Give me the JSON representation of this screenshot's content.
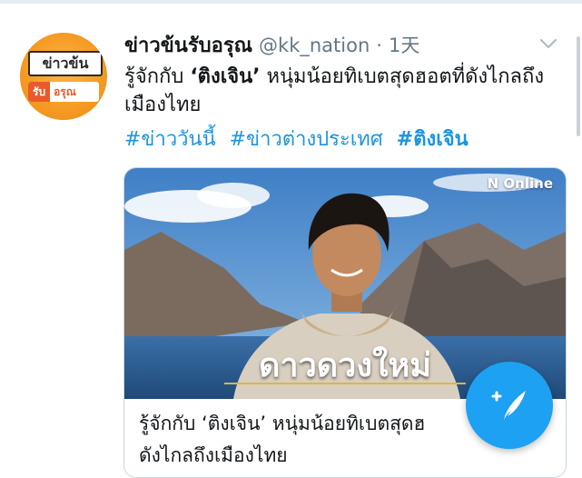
{
  "tweet": {
    "author_name": "ข่าวข้นรับอรุณ",
    "handle": "@kk_nation",
    "separator": "·",
    "time": "1天",
    "text_prefix": "รู้จักกับ ",
    "text_bold": "‘ติงเจิน’",
    "text_suffix": " หนุ่มน้อยทิเบตสุดฮอตที่ดังไกลถึงเมืองไทย",
    "hashtags": [
      "#ข่าววันนี้",
      "#ข่าวต่างประเทศ",
      "#ติงเจิน"
    ]
  },
  "avatar": {
    "line1": "ข่าวข้น",
    "line2a": "รับ",
    "line2b": "อรุณ"
  },
  "card": {
    "watermark": "N Online",
    "caption": "ดาวดวงใหม่",
    "title": "รู้จักกับ ‘ติงเจิน’ หนุ่มน้อยทิเบตสุดฮ",
    "subtitle": "ดังไกลถึงเมืองไทย"
  },
  "fab": {
    "icon": "compose-tweet-icon"
  },
  "colors": {
    "link": "#1b95e0",
    "accent": "#1da1f2",
    "muted": "#657786"
  }
}
